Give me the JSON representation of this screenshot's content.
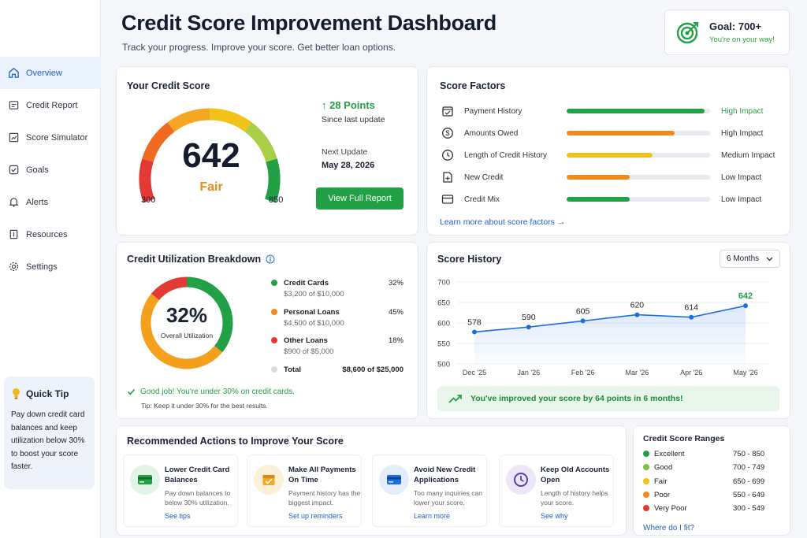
{
  "sidebar": {
    "items": [
      {
        "label": "Overview",
        "icon": "home-icon"
      },
      {
        "label": "Credit Report",
        "icon": "report-icon"
      },
      {
        "label": "Score Simulator",
        "icon": "simulator-icon"
      },
      {
        "label": "Goals",
        "icon": "goals-icon"
      },
      {
        "label": "Alerts",
        "icon": "bell-icon"
      },
      {
        "label": "Resources",
        "icon": "book-icon"
      },
      {
        "label": "Settings",
        "icon": "gear-icon"
      }
    ],
    "tip": {
      "title": "Quick Tip",
      "text": "Pay down credit card balances and keep utilization below 30% to boost your score faster."
    }
  },
  "header": {
    "title": "Credit Score Improvement Dashboard",
    "subtitle": "Track your progress. Improve your score. Get better loan options."
  },
  "goal": {
    "title": "Goal: 700+",
    "subtitle": "You're on your way!"
  },
  "credit_score": {
    "title": "Your Credit Score",
    "score": "642",
    "rating": "Fair",
    "min": "300",
    "max": "850",
    "change": "↑ 28 Points",
    "change_sub": "Since last update",
    "next_update_label": "Next Update",
    "next_update_date": "May 28, 2026",
    "button": "View Full Report",
    "value": 642
  },
  "factors": {
    "title": "Score Factors",
    "items": [
      {
        "label": "Payment History",
        "impact": "High Impact",
        "level": 0.96,
        "color": "#21a046",
        "impact_color": "#21a046",
        "icon": "calendar-check-icon"
      },
      {
        "label": "Amounts Owed",
        "impact": "High Impact",
        "level": 0.75,
        "color": "#f08a1c",
        "impact_color": "#333333",
        "icon": "dollar-icon"
      },
      {
        "label": "Length of Credit History",
        "impact": "Medium Impact",
        "level": 0.6,
        "color": "#f2c21b",
        "impact_color": "#333333",
        "icon": "clock-icon"
      },
      {
        "label": "New Credit",
        "impact": "Low Impact",
        "level": 0.44,
        "color": "#f08a1c",
        "impact_color": "#333333",
        "icon": "new-doc-icon"
      },
      {
        "label": "Credit Mix",
        "impact": "Low Impact",
        "level": 0.44,
        "color": "#21a046",
        "impact_color": "#333333",
        "icon": "card-icon"
      }
    ],
    "link": "Learn more about score factors →"
  },
  "utilization": {
    "title": "Credit Utilization Breakdown",
    "percent": "32%",
    "center_label": "Overall Utilization",
    "items": [
      {
        "name": "Credit Cards",
        "detail": "$3,200 of $10,000",
        "pct": "32%",
        "color": "#21a046"
      },
      {
        "name": "Personal Loans",
        "detail": "$4,500 of $10,000",
        "pct": "45%",
        "color": "#f08a1c"
      },
      {
        "name": "Other Loans",
        "detail": "$900 of $5,000",
        "pct": "18%",
        "color": "#e53935"
      }
    ],
    "total_label": "Total",
    "total_value": "$8,600 of $25,000",
    "good_msg": "Good job! You're under 30% on credit cards.",
    "tip": "Tip: Keep it under 30% for the best results."
  },
  "history": {
    "title": "Score History",
    "range_select": "6 Months",
    "banner": "You've improved your score by 64 points in 6 months!"
  },
  "chart_data": {
    "type": "line",
    "title": "Score History",
    "categories": [
      "Dec '25",
      "Jan '26",
      "Feb '26",
      "Mar '26",
      "Apr '26",
      "May '26"
    ],
    "series": [
      {
        "values": [
          578,
          590,
          605,
          620,
          614,
          642
        ]
      }
    ],
    "ylim": [
      500,
      700
    ],
    "yticks": [
      500,
      550,
      600,
      650,
      700
    ],
    "grid": true,
    "line_color": "#1d6ee6",
    "last_label_color": "#21a046"
  },
  "actions": {
    "title": "Recommended Actions to Improve Your Score",
    "items": [
      {
        "title": "Lower Credit Card Balances",
        "desc": "Pay down balances to below 30% utilization.",
        "link": "See tips",
        "bg": "#e3f4e6",
        "fg": "#21a046",
        "icon": "credit-card-icon"
      },
      {
        "title": "Make All Payments On Time",
        "desc": "Payment history has the biggest impact.",
        "link": "Set up reminders",
        "bg": "#fdf0d8",
        "fg": "#f08a1c",
        "icon": "calendar-icon"
      },
      {
        "title": "Avoid New Credit Applications",
        "desc": "Too many inquiries can lower your score.",
        "link": "Learn more",
        "bg": "#e3edfb",
        "fg": "#1d6ee6",
        "icon": "card-icon"
      },
      {
        "title": "Keep Old Accounts Open",
        "desc": "Length of history helps your score.",
        "link": "See why",
        "bg": "#ece6f8",
        "fg": "#6a4bc4",
        "icon": "clock-icon"
      }
    ]
  },
  "ranges": {
    "title": "Credit Score Ranges",
    "items": [
      {
        "name": "Excellent",
        "range": "750 - 850",
        "color": "#21a046"
      },
      {
        "name": "Good",
        "range": "700 - 749",
        "color": "#7cc242"
      },
      {
        "name": "Fair",
        "range": "650 - 699",
        "color": "#f2c21b"
      },
      {
        "name": "Poor",
        "range": "550 - 649",
        "color": "#f08a1c"
      },
      {
        "name": "Very Poor",
        "range": "300 - 549",
        "color": "#e53935"
      }
    ],
    "link": "Where do I fit?"
  }
}
